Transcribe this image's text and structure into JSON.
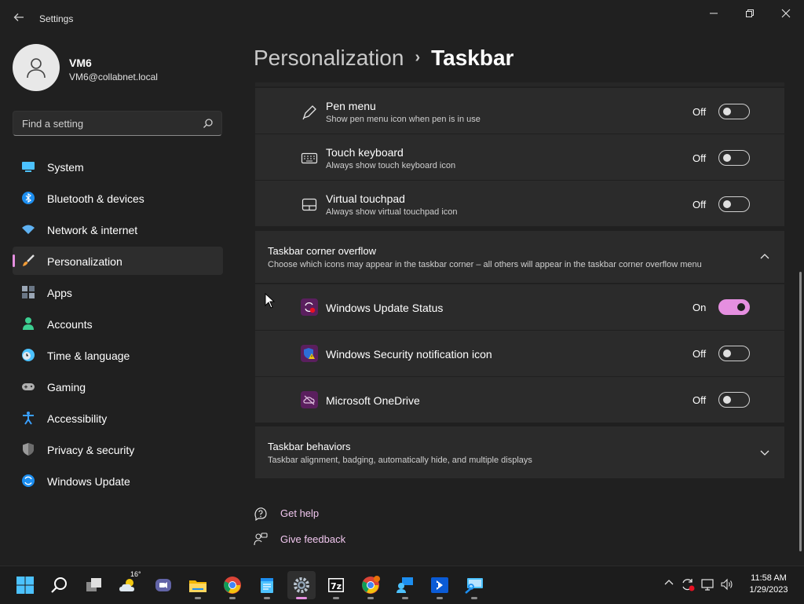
{
  "window": {
    "title": "Settings",
    "back_icon": "back-arrow-icon",
    "minimize_icon": "minimize-icon",
    "maximize_icon": "restore-icon",
    "close_icon": "close-icon"
  },
  "user": {
    "name": "VM6",
    "email": "VM6@collabnet.local"
  },
  "search": {
    "placeholder": "Find a setting",
    "icon": "search-icon"
  },
  "nav": {
    "items": [
      {
        "label": "System",
        "icon": "system-icon",
        "color": "#4cc2ff"
      },
      {
        "label": "Bluetooth & devices",
        "icon": "bluetooth-icon",
        "color": "#1c8ef0"
      },
      {
        "label": "Network & internet",
        "icon": "wifi-icon",
        "color": "#5fb2f2"
      },
      {
        "label": "Personalization",
        "icon": "brush-icon",
        "color": "#f29c38",
        "active": true
      },
      {
        "label": "Apps",
        "icon": "apps-icon",
        "color": "#9aa6b5"
      },
      {
        "label": "Accounts",
        "icon": "accounts-icon",
        "color": "#3ccf91"
      },
      {
        "label": "Time & language",
        "icon": "clock-globe-icon",
        "color": "#4cc2ff"
      },
      {
        "label": "Gaming",
        "icon": "gamepad-icon",
        "color": "#b0b0b0"
      },
      {
        "label": "Accessibility",
        "icon": "accessibility-icon",
        "color": "#3aa0ff"
      },
      {
        "label": "Privacy & security",
        "icon": "shield-icon",
        "color": "#9a9a9a"
      },
      {
        "label": "Windows Update",
        "icon": "windows-update-icon",
        "color": "#1c8ef0"
      }
    ]
  },
  "breadcrumb": {
    "parent": "Personalization",
    "separator": "›",
    "current": "Taskbar"
  },
  "pen_rows": [
    {
      "title": "Pen menu",
      "subtitle": "Show pen menu icon when pen is in use",
      "state": "Off",
      "on": false,
      "icon": "pen-icon"
    },
    {
      "title": "Touch keyboard",
      "subtitle": "Always show touch keyboard icon",
      "state": "Off",
      "on": false,
      "icon": "keyboard-icon"
    },
    {
      "title": "Virtual touchpad",
      "subtitle": "Always show virtual touchpad icon",
      "state": "Off",
      "on": false,
      "icon": "touchpad-icon"
    }
  ],
  "overflow": {
    "title": "Taskbar corner overflow",
    "subtitle": "Choose which icons may appear in the taskbar corner – all others will appear in the taskbar corner overflow menu",
    "chevron": "chevron-up-icon",
    "rows": [
      {
        "title": "Windows Update Status",
        "state": "On",
        "on": true,
        "icon": "windows-update-status-icon"
      },
      {
        "title": "Windows Security notification icon",
        "state": "Off",
        "on": false,
        "icon": "windows-security-icon"
      },
      {
        "title": "Microsoft OneDrive",
        "state": "Off",
        "on": false,
        "icon": "onedrive-icon"
      }
    ]
  },
  "behaviors": {
    "title": "Taskbar behaviors",
    "subtitle": "Taskbar alignment, badging, automatically hide, and multiple displays",
    "chevron": "chevron-down-icon"
  },
  "links": [
    {
      "label": "Get help",
      "icon": "help-icon"
    },
    {
      "label": "Give feedback",
      "icon": "feedback-icon"
    }
  ],
  "accent_color": "#e58fe0",
  "taskbar": {
    "weather_temp": "16°",
    "apps": [
      "start-icon",
      "search-icon",
      "task-view-icon",
      "weather-icon",
      "teams-chat-icon",
      "file-explorer-icon",
      "chrome-icon",
      "notepad-icon",
      "settings-icon",
      "7zip-icon",
      "chrome-profile-icon",
      "remote-desktop-icon",
      "app-icon",
      "network-app-icon"
    ],
    "tray": [
      "chevron-up-icon",
      "windows-update-tray-icon",
      "network-icon",
      "volume-icon"
    ],
    "time": "11:58 AM",
    "date": "1/29/2023"
  }
}
